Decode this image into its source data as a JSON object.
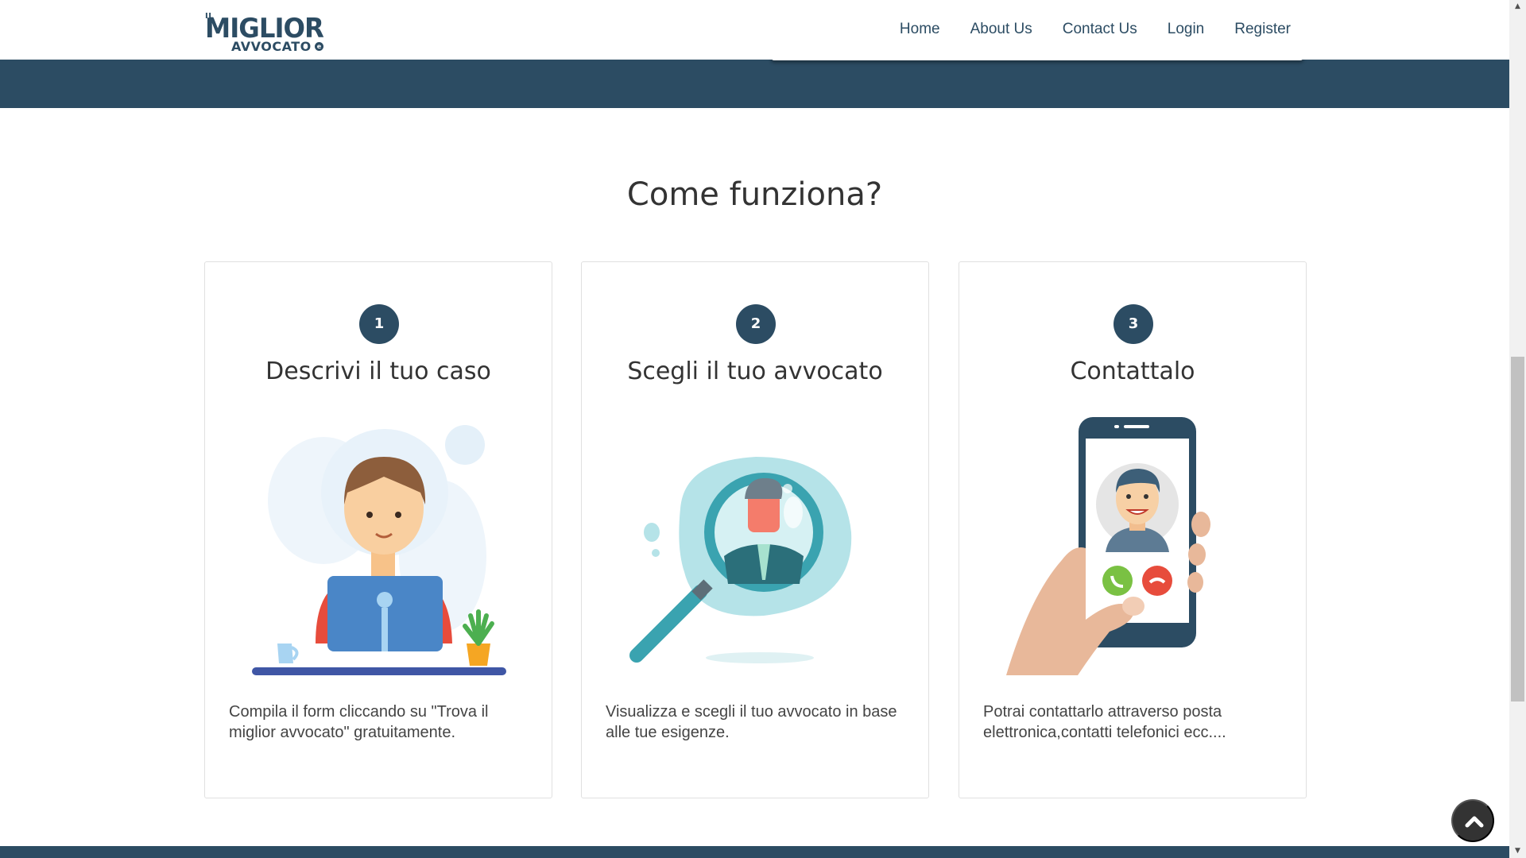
{
  "logo": {
    "il": "IL",
    "miglior": "MIGLIOR",
    "avvocato": "AVVOCATO",
    "mark": "e"
  },
  "nav": {
    "home": "Home",
    "about": "About Us",
    "contact": "Contact Us",
    "login": "Login",
    "register": "Register"
  },
  "section": {
    "title": "Come funziona?"
  },
  "steps": [
    {
      "number": "1",
      "title": "Descrivi il tuo caso",
      "description": "Compila il form cliccando su \"Trova il miglior avvocato\" gratuitamente."
    },
    {
      "number": "2",
      "title": "Scegli il tuo avvocato",
      "description": "Visualizza e scegli il tuo avvocato in base alle tue esigenze."
    },
    {
      "number": "3",
      "title": "Contattalo",
      "description": "Potrai contattarlo attraverso posta elettronica,contatti telefonici ecc...."
    }
  ],
  "icons": {
    "back_to_top": "chevron-up-icon"
  },
  "colors": {
    "brand": "#2c4c63",
    "footer": "#2c4c63",
    "back_to_top": "#333333"
  }
}
